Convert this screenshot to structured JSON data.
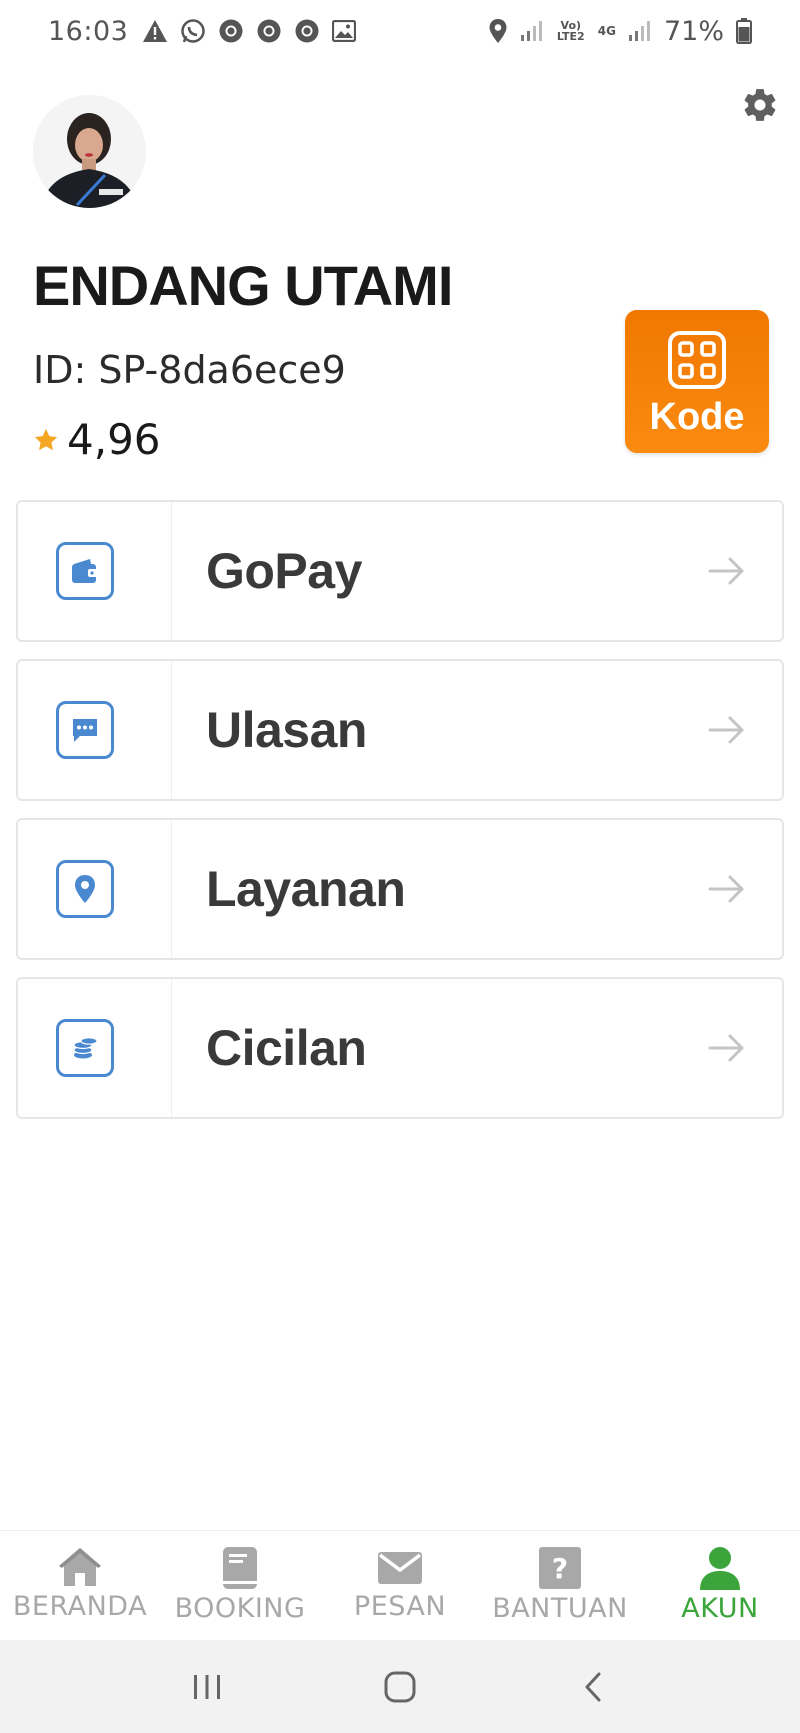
{
  "status_bar": {
    "time": "16:03",
    "battery": "71%",
    "lte_label": "Vo) LTE2",
    "net_label": "4G",
    "left_icons": [
      "warning-icon",
      "whatsapp-icon",
      "chrome-icon",
      "chrome-icon",
      "chrome-icon",
      "image-icon"
    ],
    "right_icons": [
      "location-icon",
      "signal-icon",
      "signal-icon",
      "battery-icon"
    ]
  },
  "profile": {
    "name": "ENDANG UTAMI",
    "id_text": "ID: SP-8da6ece9",
    "rating": "4,96"
  },
  "kode_button": {
    "label": "Kode"
  },
  "menu": [
    {
      "label": "GoPay",
      "icon": "wallet-icon"
    },
    {
      "label": "Ulasan",
      "icon": "chat-icon"
    },
    {
      "label": "Layanan",
      "icon": "location-pin-icon"
    },
    {
      "label": "Cicilan",
      "icon": "coins-icon"
    }
  ],
  "bottom_nav": [
    {
      "label": "BERANDA",
      "icon": "home-icon",
      "active": false
    },
    {
      "label": "BOOKING",
      "icon": "book-icon",
      "active": false
    },
    {
      "label": "PESAN",
      "icon": "mail-icon",
      "active": false
    },
    {
      "label": "BANTUAN",
      "icon": "help-icon",
      "active": false
    },
    {
      "label": "AKUN",
      "icon": "user-icon",
      "active": true
    }
  ],
  "colors": {
    "accent_orange": "#f58200",
    "icon_blue": "#4a89d0",
    "active_green": "#3ba53b",
    "star": "#f5a623"
  }
}
